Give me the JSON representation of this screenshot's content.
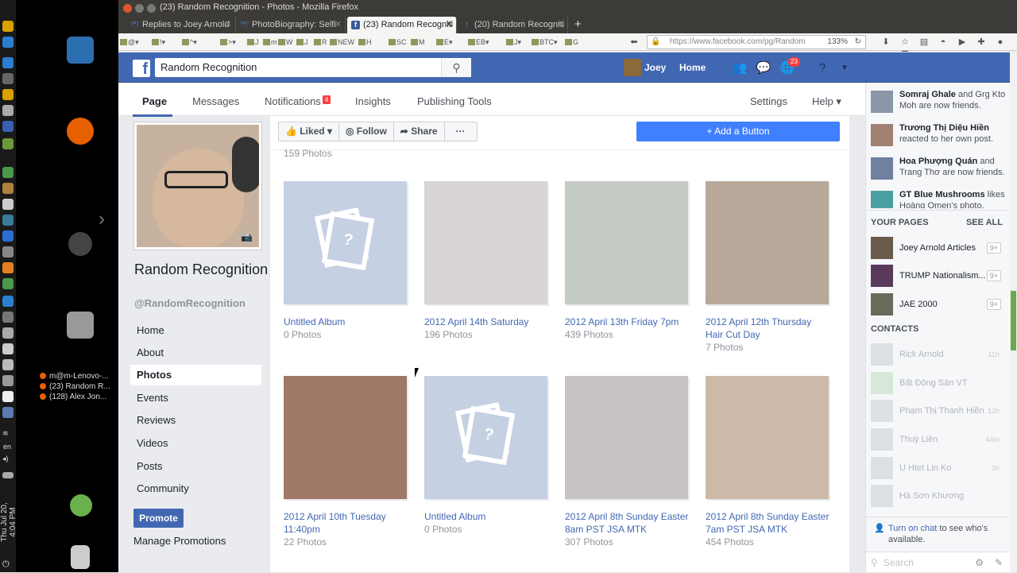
{
  "desktop": {
    "clock": "Thu Jul 20, 4:04 PM",
    "lang": "en",
    "task_windows": [
      "m@m-Lenovo-...",
      "(23) Random R...",
      "(128) Alex Jon..."
    ]
  },
  "browser": {
    "window_title": "(23) Random Recognition - Photos - Mozilla Firefox",
    "tabs": [
      {
        "label": "Replies to Joey Arnold",
        "icon": "twitter-icon"
      },
      {
        "label": "PhotoBiography: Selfi",
        "icon": "twitter-icon"
      },
      {
        "label": "(23) Random Recogniti",
        "icon": "facebook-icon",
        "active": true
      },
      {
        "label": "(20) Random Recogniti",
        "icon": "facebook-icon"
      }
    ],
    "new_tab": "+",
    "bookmarks": [
      "@▾",
      "!▾",
      "^▾",
      ">▾",
      "J",
      "m",
      "W",
      "J",
      "R",
      "NEW",
      "H",
      "SC",
      "M",
      "E▾",
      "EB▾",
      "J▾",
      "BTC▾",
      "G"
    ],
    "url": "https://www.facebook.com/pg/Random",
    "zoom": "133%"
  },
  "fb": {
    "search_value": "Random Recognition",
    "user": "Joey",
    "home": "Home",
    "notif_count": "23"
  },
  "page_nav": {
    "tabs": [
      "Page",
      "Messages",
      "Notifications",
      "Insights",
      "Publishing Tools"
    ],
    "notif_badge": "4",
    "settings": "Settings",
    "help": "Help ▾"
  },
  "left": {
    "page_name": "Random Recognition",
    "handle": "@RandomRecognition",
    "nav": [
      "Home",
      "About",
      "Photos",
      "Events",
      "Reviews",
      "Videos",
      "Posts",
      "Community"
    ],
    "active_nav": "Photos",
    "promote": "Promote",
    "manage": "Manage Promotions"
  },
  "actions": {
    "liked": "Liked ▾",
    "follow": "Follow",
    "share": "Share",
    "more": "···",
    "add_button": "+ Add a Button"
  },
  "photos_count": "159 Photos",
  "albums": [
    {
      "title": "Untitled Album",
      "count": "0 Photos",
      "placeholder": true
    },
    {
      "title": "2012 April 14th Saturday",
      "count": "196 Photos",
      "color": "#d9d4d8"
    },
    {
      "title": "2012 April 13th Friday 7pm",
      "count": "439 Photos",
      "color": "#c5ccc5"
    },
    {
      "title": "2012 April 12th Thursday Hair Cut Day",
      "count": "7 Photos",
      "color": "#b8a89a"
    },
    {
      "title": "2012 April 10th Tuesday 11:40pm",
      "count": "22 Photos",
      "color": "#a07868"
    },
    {
      "title": "Untitled Album",
      "count": "0 Photos",
      "placeholder": true
    },
    {
      "title": "2012 April 8th Sunday Easter 8am PST JSA MTK",
      "count": "307 Photos",
      "color": "#c9c4c4"
    },
    {
      "title": "2012 April 8th Sunday Easter 7am PST JSA MTK",
      "count": "454 Photos",
      "color": "#cdb9a8"
    }
  ],
  "right": {
    "ticker": [
      {
        "name": "Somraj Ghale",
        "text": " and Grg Kto Moh are now friends."
      },
      {
        "name": "Trương Thị Diệu Hiền",
        "text": " reacted to her own post."
      },
      {
        "name": "Hoa Phượng Quán",
        "text": " and Trang Thơ are now friends."
      },
      {
        "name": "GT Blue Mushrooms",
        "text": " likes Hoàng Omen's photo."
      }
    ],
    "your_pages": "YOUR PAGES",
    "see_all": "SEE ALL",
    "pages": [
      {
        "name": "Joey Arnold Articles",
        "count": "9+"
      },
      {
        "name": "TRUMP Nationalism...",
        "count": "9+"
      },
      {
        "name": "JAE 2000",
        "count": "9+"
      }
    ],
    "contacts_label": "CONTACTS",
    "contacts": [
      {
        "name": "Rick Arnold",
        "time": "11h"
      },
      {
        "name": "Bất Động Sản VT",
        "time": ""
      },
      {
        "name": "Phạm Thị Thanh Hiền",
        "time": "12h"
      },
      {
        "name": "Thuỳ Liên",
        "time": "44m"
      },
      {
        "name": "U Htet Lin Ko",
        "time": "3h"
      },
      {
        "name": "Hà Sơn Khương",
        "time": ""
      }
    ],
    "turn_on": "Turn on chat",
    "turn_on_rest": " to see who's available.",
    "chat_search": "Search"
  }
}
